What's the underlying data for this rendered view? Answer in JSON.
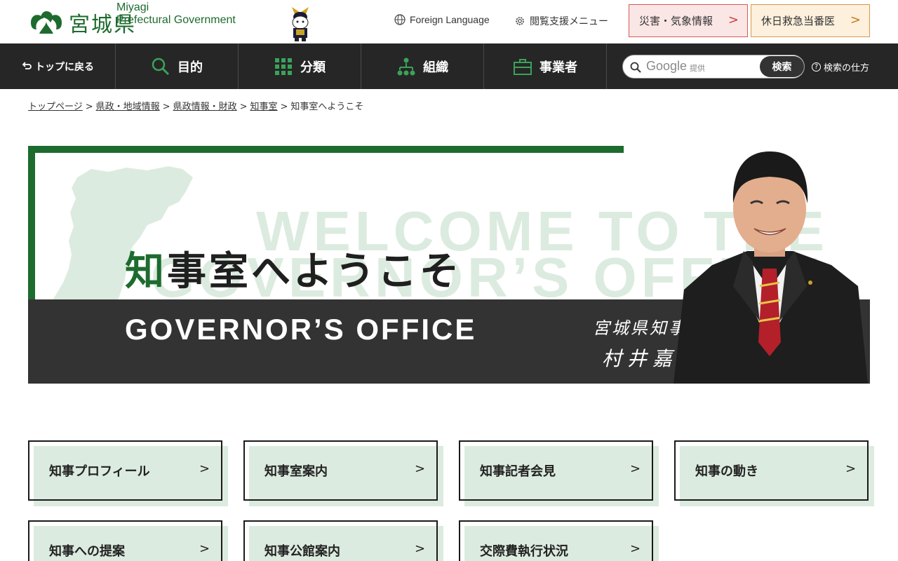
{
  "header": {
    "logo_jp": "宮城県",
    "logo_en_line1": "Miyagi",
    "logo_en_line2": "Prefectural Government",
    "foreign_language": "Foreign Language",
    "accessibility_menu": "閲覧支援メニュー",
    "disaster_label": "災害・気象情報",
    "medical_label": "休日救急当番医",
    "arrow": ">"
  },
  "nav": {
    "back_to_top": "トップに戻る",
    "items": [
      {
        "label": "目的"
      },
      {
        "label": "分類"
      },
      {
        "label": "組織"
      },
      {
        "label": "事業者"
      }
    ],
    "search_google": "Google",
    "search_provided": "提供",
    "search_button": "検索",
    "search_help": "検索の仕方"
  },
  "breadcrumb": {
    "items": [
      "トップページ",
      "県政・地域情報",
      "県政情報・財政",
      "知事室"
    ],
    "current": "知事室へようこそ",
    "separator": ">"
  },
  "hero": {
    "watermark_line1": "WELCOME TO THE",
    "watermark_line2": "GOVERNOR’S OFFICE",
    "title_accent": "知",
    "title_rest": "事室へようこそ",
    "title_en": "GOVERNOR’S OFFICE",
    "signature_title": "宮城県知事",
    "signature_name": "村井嘉浩"
  },
  "tiles": [
    {
      "label": "知事プロフィール"
    },
    {
      "label": "知事室案内"
    },
    {
      "label": "知事記者会見"
    },
    {
      "label": "知事の動き"
    },
    {
      "label": "知事への提案"
    },
    {
      "label": "知事公館案内"
    },
    {
      "label": "交際費執行状況"
    }
  ],
  "colors": {
    "brand_green": "#1d6b2e",
    "tile_shadow": "#dcebdf",
    "nav_bg": "#262626"
  }
}
